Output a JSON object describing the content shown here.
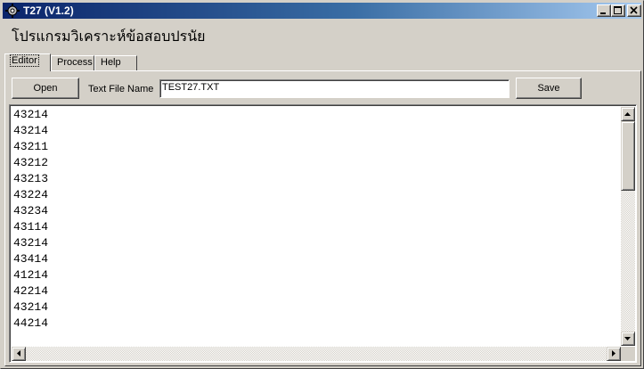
{
  "window": {
    "title": "T27 (V1.2)",
    "app_icon": "gear-app-icon",
    "controls": [
      "minimize-icon",
      "maximize-icon",
      "close-icon"
    ]
  },
  "heading": "โปรแกรมวิเคราะห์ข้อสอบปรนัย",
  "tabs": [
    {
      "label": "Editor",
      "active": true
    },
    {
      "label": "Process",
      "active": false
    },
    {
      "label": "Help",
      "active": false
    }
  ],
  "toolbar": {
    "open_label": "Open",
    "filename_label": "Text File Name",
    "filename_value": "TEST27.TXT",
    "save_label": "Save"
  },
  "editor": {
    "lines": [
      "43214",
      "43214",
      "43211",
      "43212",
      "43213",
      "43224",
      "43234",
      "43114",
      "43214",
      "43414",
      "41214",
      "42214",
      "43214",
      "44214"
    ]
  }
}
